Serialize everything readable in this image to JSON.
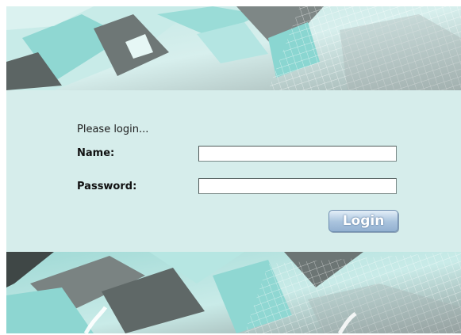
{
  "login": {
    "prompt": "Please login...",
    "name_label": "Name:",
    "name_value": "",
    "password_label": "Password:",
    "password_value": "",
    "login_button": "Login"
  },
  "colors": {
    "panel_background": "#d6edeb",
    "banner_teal": "#8cd6d2",
    "banner_gray": "#7b8483",
    "button_blue": "#a9c3dd"
  }
}
